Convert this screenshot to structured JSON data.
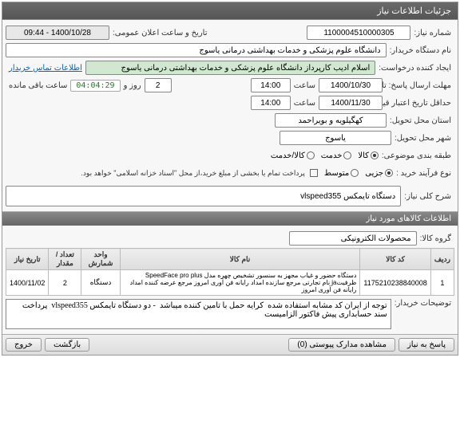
{
  "header": {
    "title": "جزئیات اطلاعات نیاز"
  },
  "form": {
    "need_no_lbl": "شماره نیاز:",
    "need_no": "1100004510000305",
    "announce_lbl": "تاریخ و ساعت اعلان عمومی:",
    "announce": "1400/10/28 - 09:44",
    "buyer_lbl": "نام دستگاه خریدار:",
    "buyer": "دانشگاه علوم پزشکی و خدمات بهداشتی  درمانی یاسوج",
    "requester_lbl": "ایجاد کننده درخواست:",
    "requester": "اسلام  ادیب کارپرداز دانشگاه علوم پزشکی و خدمات بهداشتی  درمانی یاسوج",
    "contact_link": "اطلاعات تماس خریدار",
    "deadline_lbl": "مهلت ارسال پاسخ: تا تاریخ:",
    "deadline_date": "1400/10/30",
    "time_lbl": "ساعت",
    "deadline_time": "14:00",
    "day_lbl": "روز و",
    "days_left": "2",
    "remain_lbl": "ساعت باقی مانده",
    "timer": "04:04:29",
    "validity_lbl": "حداقل تاریخ اعتبار قیمت: تا تاریخ:",
    "validity_date": "1400/11/30",
    "validity_time": "14:00",
    "province_lbl": "استان محل تحویل:",
    "province": "کهگیلویه و بویراحمد",
    "city_lbl": "شهر محل تحویل:",
    "city": "یاسوج",
    "subject_cls_lbl": "طبقه بندی موضوعی:",
    "cls_goods": "کالا",
    "cls_service": "خدمت",
    "cls_both": "کالا/خدمت",
    "process_lbl": "نوع فرآیند خرید :",
    "proc_low": "جزیی",
    "proc_mid": "متوسط",
    "proc_note": "پرداخت تمام یا بخشی از مبلغ خرید،از محل \"اسناد خزانه اسلامی\" خواهد بود.",
    "need_title_lbl": "شرح کلی نیاز:",
    "need_title": "دستگاه تایمکس vlspeed355"
  },
  "items_section": {
    "title": "اطلاعات کالاهای مورد نیاز",
    "group_lbl": "گروه کالا:",
    "group": "محصولات الکترونیکی",
    "cols": [
      "ردیف",
      "کد کالا",
      "نام کالا",
      "واحد شمارش",
      "تعداد / مقدار",
      "تاریخ نیاز"
    ],
    "rows": [
      {
        "idx": "1",
        "code": "1175210238840008",
        "name": "دستگاه حضور و غیاب مجهز به سنسور تشخیص چهره مدل SpeedFace pro plus ظرفیتja نام تجارتی مرجع سازنده امداد رایانه فن آوری امروز مرجع عرضه کننده امداد رایانه فن آوری امروز",
        "unit": "دستگاه",
        "qty": "2",
        "date": "1400/11/02"
      }
    ],
    "desc_lbl": "توضیحات خریدار:",
    "desc": "توجه از ایران کد مشابه استفاده شده  کرایه حمل با تامین کننده میباشد  - دو دستگاه تایمکس vlspeed355  پرداخت سند حسابداری پیش فاکتور الزامیست"
  },
  "footer": {
    "respond": "پاسخ به نیاز",
    "attach": "مشاهده مدارک پیوستی (0)",
    "back": "بازگشت",
    "exit": "خروج"
  }
}
